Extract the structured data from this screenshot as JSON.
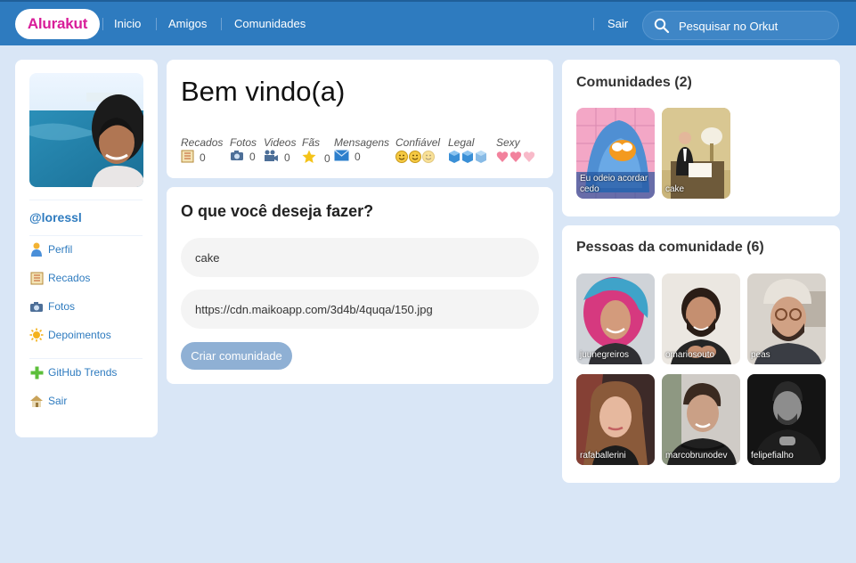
{
  "header": {
    "logo": "Alurakut",
    "nav": [
      "Inicio",
      "Amigos",
      "Comunidades"
    ],
    "logout": "Sair",
    "search_placeholder": "Pesquisar no Orkut"
  },
  "sidebar": {
    "username": "@loressl",
    "items": [
      {
        "label": "Perfil",
        "icon": "user-icon"
      },
      {
        "label": "Recados",
        "icon": "notebook-icon"
      },
      {
        "label": "Fotos",
        "icon": "camera-icon"
      },
      {
        "label": "Depoimentos",
        "icon": "sun-icon"
      },
      {
        "label": "GitHub Trends",
        "icon": "plus-icon"
      },
      {
        "label": "Sair",
        "icon": "home-icon"
      }
    ]
  },
  "welcome": {
    "title": "Bem vindo(a)",
    "stats": [
      {
        "label": "Recados",
        "value": "0",
        "icon": "notebook-icon"
      },
      {
        "label": "Fotos",
        "value": "0",
        "icon": "camera-icon"
      },
      {
        "label": "Videos",
        "value": "0",
        "icon": "video-camera-icon"
      },
      {
        "label": "Fãs",
        "value": "0",
        "icon": "star-icon"
      },
      {
        "label": "Mensagens",
        "value": "0",
        "icon": "envelope-icon"
      },
      {
        "label": "Confiável",
        "icon": "smiley-icon",
        "rating": 3
      },
      {
        "label": "Legal",
        "icon": "ice-cube-icon",
        "rating": 3
      },
      {
        "label": "Sexy",
        "icon": "heart-icon",
        "rating": 3
      }
    ]
  },
  "form": {
    "title": "O que você deseja fazer?",
    "name_value": "cake",
    "image_value": "https://cdn.maikoapp.com/3d4b/4quqa/150.jpg",
    "submit": "Criar comunidade"
  },
  "communities": {
    "title": "Comunidades (2)",
    "items": [
      {
        "name": "Eu odeio acordar cedo"
      },
      {
        "name": "cake"
      }
    ]
  },
  "people": {
    "title": "Pessoas da comunidade (6)",
    "items": [
      {
        "name": "juunegreiros"
      },
      {
        "name": "omariosouto"
      },
      {
        "name": "peas"
      },
      {
        "name": "rafaballerini"
      },
      {
        "name": "marcobrunodev"
      },
      {
        "name": "felipefialho"
      }
    ]
  }
}
